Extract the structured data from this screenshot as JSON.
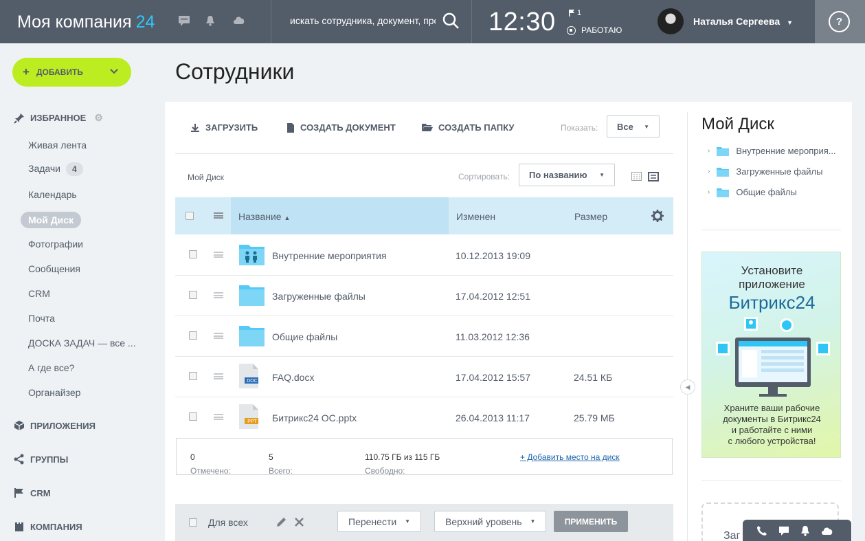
{
  "header": {
    "logo_text": "Моя компания",
    "logo_num": "24",
    "search_placeholder": "искать сотрудника, документ, прочее...",
    "time": "12:30",
    "flag_count": "1",
    "work_status": "РАБОТАЮ",
    "user_name": "Наталья Сергеева",
    "help": "?"
  },
  "sidebar": {
    "add_label": "ДОБАВИТЬ",
    "favorites_label": "ИЗБРАННОЕ",
    "items": [
      {
        "label": "Живая лента"
      },
      {
        "label": "Задачи",
        "count": "4"
      },
      {
        "label": "Календарь"
      },
      {
        "label": "Мой Диск"
      },
      {
        "label": "Фотографии"
      },
      {
        "label": "Сообщения"
      },
      {
        "label": "CRM"
      },
      {
        "label": "Почта"
      },
      {
        "label": "ДОСКА ЗАДАЧ — все ..."
      },
      {
        "label": "А где все?"
      },
      {
        "label": "Органайзер"
      }
    ],
    "sections": [
      {
        "label": "ПРИЛОЖЕНИЯ"
      },
      {
        "label": "ГРУППЫ"
      },
      {
        "label": "CRM"
      },
      {
        "label": "КОМПАНИЯ"
      }
    ]
  },
  "page": {
    "title": "Сотрудники"
  },
  "toolbar": {
    "upload": "ЗАГРУЗИТЬ",
    "create_doc": "СОЗДАТЬ ДОКУМЕНТ",
    "create_folder": "СОЗДАТЬ ПАПКУ",
    "show_label": "Показать:",
    "show_value": "Все",
    "breadcrumb": "Мой Диск",
    "sort_label": "Сортировать:",
    "sort_value": "По названию"
  },
  "table": {
    "columns": {
      "name": "Название",
      "modified": "Изменен",
      "size": "Размер"
    },
    "rows": [
      {
        "name": "Внутренние мероприятия",
        "modified": "10.12.2013 19:09",
        "size": "",
        "type": "shared-folder-icon"
      },
      {
        "name": "Загруженные файлы",
        "modified": "17.04.2012 12:51",
        "size": "",
        "type": "folder-icon"
      },
      {
        "name": "Общие файлы",
        "modified": "11.03.2012 12:36",
        "size": "",
        "type": "folder-icon"
      },
      {
        "name": "FAQ.docx",
        "modified": "17.04.2012 15:57",
        "size": "24.51 КБ",
        "type": "docx-file-icon",
        "badge": "DOC"
      },
      {
        "name": "Битрикс24 ОС.pptx",
        "modified": "26.04.2013 11:17",
        "size": "25.79 МБ",
        "type": "pptx-file-icon",
        "badge": "PPT"
      }
    ]
  },
  "summary": {
    "checked_label": "Отмечено:",
    "checked_value": "0",
    "total_label": "Всего:",
    "total_value": "5",
    "free_label": "Свободно:",
    "free_value": "110.75 ГБ из 115 ГБ",
    "add_space": "+ Добавить место на диск"
  },
  "bottombar": {
    "for_all": "Для всех",
    "move": "Перенести",
    "level": "Верхний уровень",
    "apply": "ПРИМЕНИТЬ"
  },
  "right": {
    "title": "Мой Диск",
    "tree": [
      {
        "label": "Внутренние мероприя..."
      },
      {
        "label": "Загруженные файлы"
      },
      {
        "label": "Общие файлы"
      }
    ],
    "banner": {
      "line1": "Установите",
      "line2": "приложение",
      "brand": "Битрикс24",
      "desc1": "Храните ваши рабочие",
      "desc2": "документы в Битрикс24",
      "desc3": "и работайте с ними",
      "desc4": "с любого устройства!"
    },
    "cut_label": "Заг"
  },
  "colors": {
    "accent": "#2fc6f6",
    "topbar": "#535c69",
    "add_button": "#bbed21",
    "folder": "#56c9f4"
  }
}
